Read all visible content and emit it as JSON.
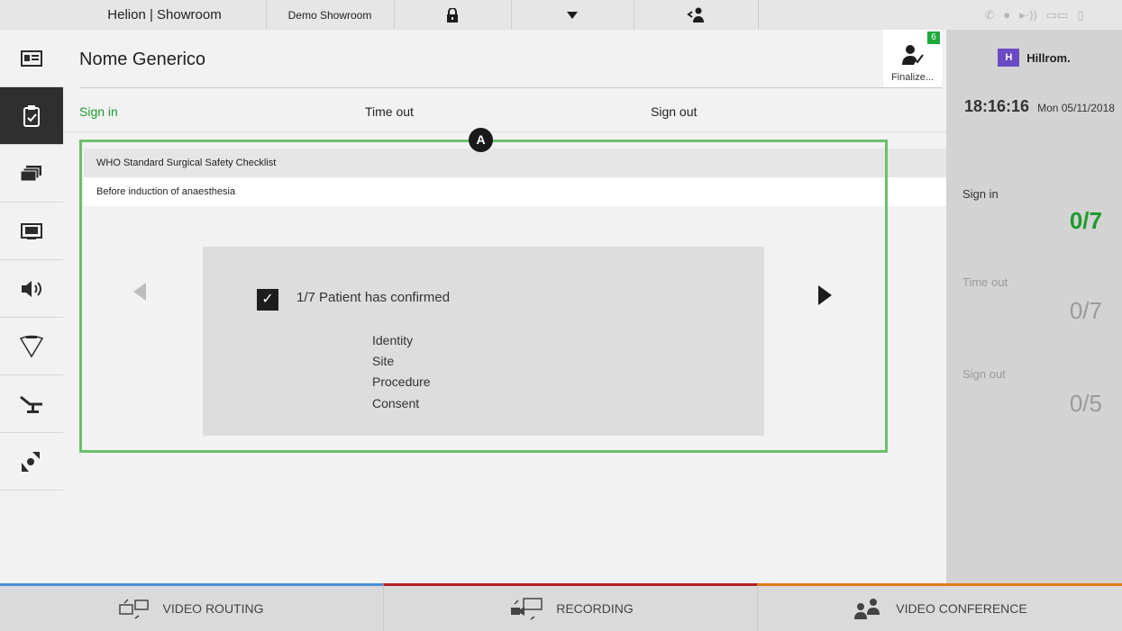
{
  "topbar": {
    "brand": "Helion | Showroom",
    "showroom": "Demo Showroom",
    "lock_icon": "lock-icon",
    "dropdown_icon": "caret-down-icon",
    "user_icon": "user-transfer-icon"
  },
  "sidebar": {
    "items": [
      {
        "icon": "patient-card-icon"
      },
      {
        "icon": "checklist-icon",
        "active": true
      },
      {
        "icon": "stack-icon"
      },
      {
        "icon": "display-icon"
      },
      {
        "icon": "speaker-icon"
      },
      {
        "icon": "surgical-light-icon"
      },
      {
        "icon": "operating-table-icon"
      },
      {
        "icon": "camera-rotate-icon"
      }
    ]
  },
  "header": {
    "title": "Nome Generico",
    "finalize_label": "Finalize...",
    "finalize_badge": "6"
  },
  "tabs": {
    "sign_in": "Sign in",
    "time_out": "Time out",
    "sign_out": "Sign out"
  },
  "checklist": {
    "header": "WHO Standard Surgical Safety Checklist",
    "section": "Before induction of anaesthesia",
    "item_text": "1/7 Patient has confirmed",
    "check_mark": "✓",
    "sub_items": [
      "Identity",
      "Site",
      "Procedure",
      "Consent"
    ],
    "callout": "A"
  },
  "right_panel": {
    "logo_mark": "H",
    "logo_text": "Hillrom.",
    "time": "18:16:16",
    "date": "Mon 05/11/2018",
    "sign_in_label": "Sign in",
    "sign_in_value": "0/7",
    "time_out_label": "Time out",
    "time_out_value": "0/7",
    "sign_out_label": "Sign out",
    "sign_out_value": "0/5"
  },
  "bottombar": {
    "video_routing": "VIDEO ROUTING",
    "recording": "RECORDING",
    "video_conference": "VIDEO CONFERENCE"
  },
  "colors": {
    "accent_green": "#1e9b2e",
    "highlight_green": "#6cbf6c",
    "routing_blue": "#4a90d9",
    "recording_red": "#b32222",
    "conference_orange": "#e07b1a"
  }
}
